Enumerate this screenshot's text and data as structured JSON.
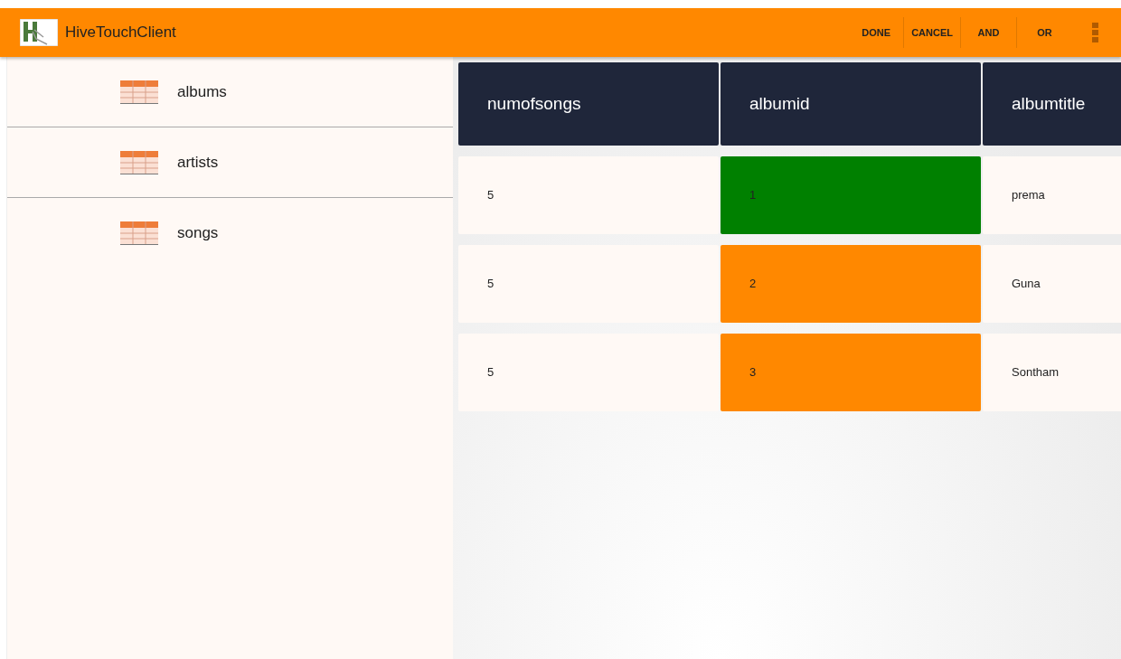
{
  "app_bar": {
    "title": "HiveTouchClient",
    "actions": [
      "DONE",
      "CANCEL",
      "AND",
      "OR"
    ]
  },
  "sidebar": {
    "items": [
      {
        "label": "albums"
      },
      {
        "label": "artists"
      },
      {
        "label": "songs"
      }
    ]
  },
  "table": {
    "columns": [
      "numofsongs",
      "albumid",
      "albumtitle"
    ],
    "rows": [
      {
        "numofsongs": "5",
        "albumid": "1",
        "albumtitle": "prema",
        "color": "#008000"
      },
      {
        "numofsongs": "5",
        "albumid": "2",
        "albumtitle": "Guna",
        "color": "#ff8800"
      },
      {
        "numofsongs": "5",
        "albumid": "3",
        "albumtitle": "Sontham",
        "color": "#ff8800"
      }
    ]
  }
}
